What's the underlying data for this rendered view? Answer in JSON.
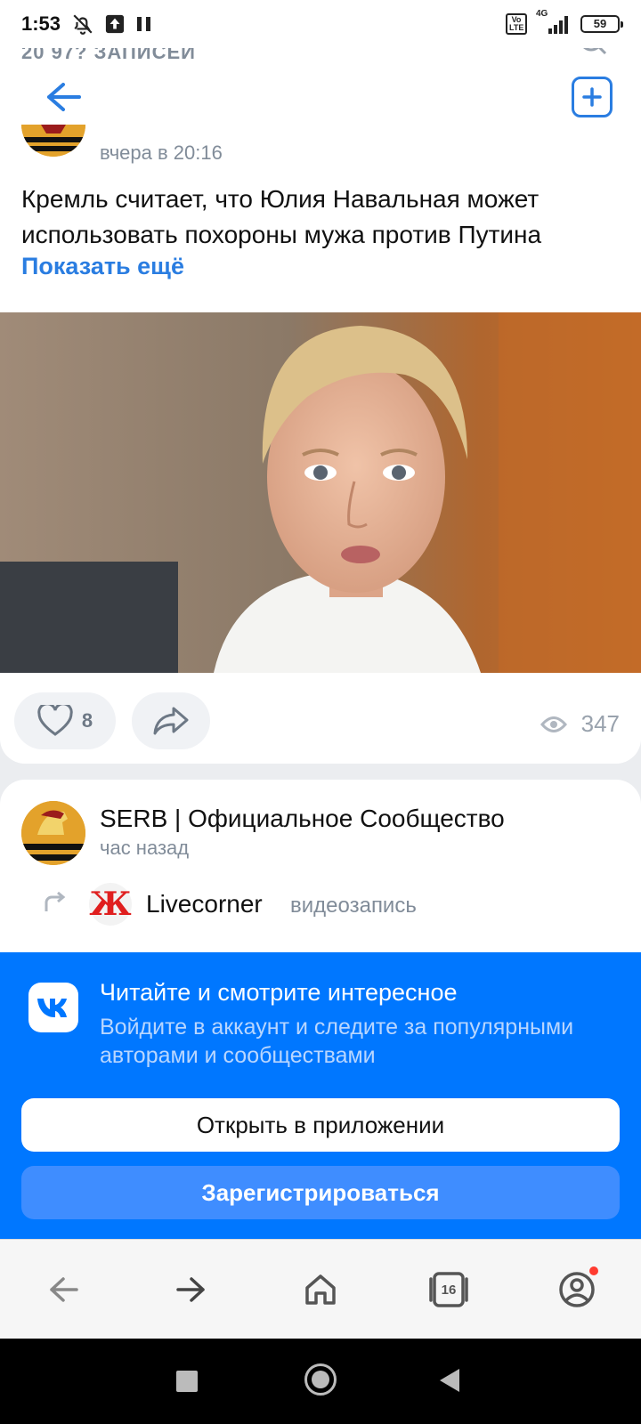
{
  "status_bar": {
    "time": "1:53",
    "network": "4G",
    "volte": "Vo LTE",
    "battery": "59"
  },
  "header": {
    "peek_text": "20 97? ЗАПИСЕЙ",
    "back_icon": "arrow-left-icon",
    "add_icon": "plus-square-icon"
  },
  "post1": {
    "time": "вчера в 20:16",
    "text": "Кремль считает, что Юлия Навальная может использовать похороны мужа против Путина",
    "show_more": "Показать ещё",
    "likes": "8",
    "views": "347"
  },
  "post2": {
    "author": "SERB | Официальное Сообщество",
    "time": "час назад",
    "repost_author": "Livecorner",
    "repost_avatar_letter": "Ж",
    "repost_type": "видеозапись"
  },
  "banner": {
    "title": "Читайте и смотрите интересное",
    "subtitle": "Войдите в аккаунт и следите за популярными авторами и сообществами",
    "open_app": "Открыть в приложении",
    "register": "Зарегистрироваться",
    "accent": "#0077ff"
  },
  "browser": {
    "tabs_count": "16"
  }
}
